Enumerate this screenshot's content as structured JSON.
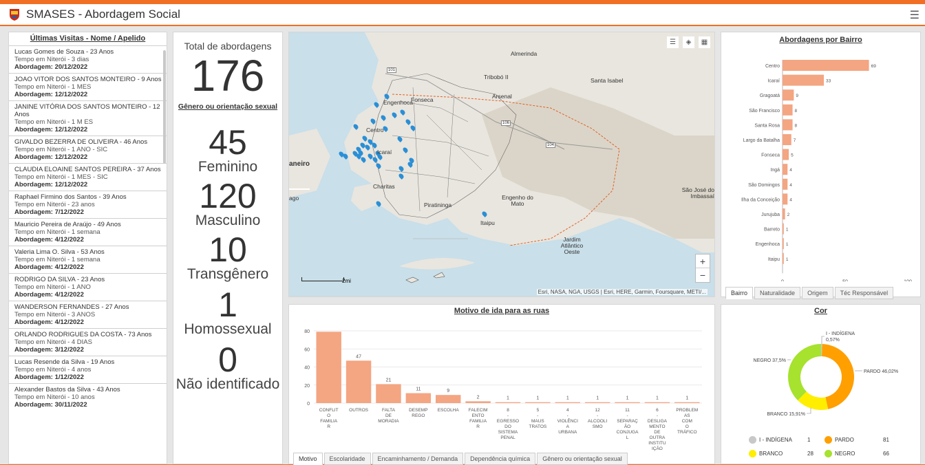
{
  "app": {
    "title": "SMASES - Abordagem Social"
  },
  "visits": {
    "heading": "Últimas Visitas - Nome / Apelido",
    "items": [
      {
        "name": "Lucas Gomes de Souza - 23 Anos",
        "tempo": "Tempo em Niterói - 3 dias",
        "abordagem": "Abordagem: 20/12/2022"
      },
      {
        "name": "JOAO VITOR DOS SANTOS MONTEIRO - 9 Anos",
        "tempo": "Tempo em Niterói - 1 MES",
        "abordagem": "Abordagem: 12/12/2022"
      },
      {
        "name": "JANINE VITÓRIA DOS SANTOS MONTEIRO - 12 Anos",
        "tempo": "Tempo em Niterói - 1 M ES",
        "abordagem": "Abordagem: 12/12/2022"
      },
      {
        "name": "GIVALDO BEZERRA DE OLIVEIRA - 46 Anos",
        "tempo": "Tempo em Niterói - 1 ANO - SIC",
        "abordagem": "Abordagem: 12/12/2022"
      },
      {
        "name": "CLAUDIA ELOAINE SANTOS PEREIRA - 37 Anos",
        "tempo": "Tempo em Niterói - 1 MES - SIC",
        "abordagem": "Abordagem: 12/12/2022"
      },
      {
        "name": "Raphael Firmino dos Santos - 39 Anos",
        "tempo": "Tempo em Niterói - 23 anos",
        "abordagem": "Abordagem: 7/12/2022"
      },
      {
        "name": "Mauricio Pereira de Araújo - 49 Anos",
        "tempo": "Tempo em Niterói - 1 semana",
        "abordagem": "Abordagem: 4/12/2022"
      },
      {
        "name": "Valeria Lima O. Silva - 53 Anos",
        "tempo": "Tempo em Niterói - 1 semana",
        "abordagem": "Abordagem: 4/12/2022"
      },
      {
        "name": "RODRIGO DA SILVA - 23 Anos",
        "tempo": "Tempo em Niterói - 1 ANO",
        "abordagem": "Abordagem: 4/12/2022"
      },
      {
        "name": "WANDERSON FERNANDES - 27 Anos",
        "tempo": "Tempo em Niterói - 3 ANOS",
        "abordagem": "Abordagem: 4/12/2022"
      },
      {
        "name": "ORLANDO RODRIGUES DA COSTA - 73 Anos",
        "tempo": "Tempo em Niterói - 4 DIAS",
        "abordagem": "Abordagem: 3/12/2022"
      },
      {
        "name": "Lucas Resende da Silva - 19 Anos",
        "tempo": "Tempo em Niterói - 4 anos",
        "abordagem": "Abordagem: 1/12/2022"
      },
      {
        "name": "Alexander Bastos da Silva - 43 Anos",
        "tempo": "Tempo em Niterói - 10 anos",
        "abordagem": "Abordagem: 30/11/2022"
      }
    ]
  },
  "stats": {
    "total_label": "Total de abordagens",
    "total": "176",
    "section": "Gênero ou orientação sexual",
    "items": [
      {
        "value": "45",
        "label": "Feminino"
      },
      {
        "value": "120",
        "label": "Masculino"
      },
      {
        "value": "10",
        "label": "Transgênero"
      },
      {
        "value": "1",
        "label": "Homossexual"
      },
      {
        "value": "0",
        "label": "Não identificado"
      }
    ]
  },
  "map": {
    "places": [
      "Almerinda",
      "Tribobó II",
      "Santa Isabel",
      "Arsenal",
      "Fonseca",
      "Engenhoca",
      "Icaraí",
      "Charitas",
      "Piratininga",
      "Engenho do Mato",
      "Itaipu",
      "Jardim Atlântico Oeste",
      "São José do Imbassaí",
      "aneiro",
      "ago",
      "Centro"
    ],
    "roads": [
      "101",
      "106",
      "104"
    ],
    "scale_label": "2mi",
    "attribution": "Esri, NASA, NGA, USGS | Esri, HERE, Garmin, Foursquare, METI/...",
    "zoom_in": "+",
    "zoom_out": "−",
    "tools": [
      "list-icon",
      "layers-icon",
      "basemap-icon"
    ]
  },
  "bairro_chart": {
    "title": "Abordagens por Bairro",
    "tabs": [
      "Bairro",
      "Naturalidade",
      "Origem",
      "Téc Responsável"
    ],
    "chart_data": {
      "type": "bar",
      "orientation": "horizontal",
      "categories": [
        "Centro",
        "Icaraí",
        "Gragoatá",
        "São Francisco",
        "Santa Rosa",
        "Largo da Batalha",
        "Fonseca",
        "Ingá",
        "São Domingos",
        "Ilha da Conceição",
        "Jurujuba",
        "Barreto",
        "Engenhoca",
        "Itaipu"
      ],
      "values": [
        69,
        33,
        9,
        8,
        8,
        7,
        5,
        4,
        4,
        4,
        2,
        1,
        1,
        1
      ],
      "xlim": [
        0,
        100
      ],
      "xticks": [
        "0",
        "50",
        "100"
      ],
      "color": "#f4a582"
    }
  },
  "motivo_chart": {
    "title": "Motivo de ida para as ruas",
    "tabs": [
      "Motivo",
      "Escolaridade",
      "Encaminhamento / Demanda",
      "Dependência química",
      "Gênero ou orientação sexual"
    ],
    "chart_data": {
      "type": "bar",
      "categories": [
        "CONFLIT O FAMILIA R",
        "OUTROS",
        "FALTA DE MORADIA",
        "DESEMP REGO",
        "ESCOLHA",
        "FALECIM ENTO FAMILIA R",
        "8 - EGRESSO DO SISTEMA PENAL",
        "5 - MAUS TRATOS",
        "4 - VIOLÊNCI A URBANA",
        "12 - ALCOOLI SMO",
        "11 - SEPARAÇ ÃO CONJUGA L",
        "6 - DESLIGA MENTO DE OUTRA INSTITU IÇÃO",
        "PROBLEM AS COM O TRÁFICO"
      ],
      "values": [
        79,
        47,
        21,
        11,
        9,
        2,
        1,
        1,
        1,
        1,
        1,
        1,
        1
      ],
      "labels": [
        "",
        "47",
        "21",
        "11",
        "9",
        "2",
        "1",
        "1",
        "1",
        "1",
        "1",
        "1",
        "1"
      ],
      "ylim": [
        0,
        80
      ],
      "yticks": [
        "0",
        "20",
        "40",
        "60",
        "80"
      ],
      "color": "#f4a582"
    }
  },
  "cor_chart": {
    "title": "Cor",
    "chart_data": {
      "type": "pie",
      "donut": true,
      "slices": [
        {
          "label": "I - INDÍGENA",
          "pct_label": "0,57%",
          "value": 1,
          "color": "#c8c8c8"
        },
        {
          "label": "PARDO",
          "pct_label": "46,02%",
          "value": 81,
          "color": "#ff9f00"
        },
        {
          "label": "BRANCO",
          "pct_label": "15,91%",
          "value": 28,
          "color": "#ffee00"
        },
        {
          "label": "NEGRO",
          "pct_label": "37,5%",
          "value": 66,
          "color": "#a6e22e"
        }
      ]
    },
    "callouts": [
      "I - INDÍGENA 0,57%",
      "PARDO 46,02%",
      "BRANCO 15,91%",
      "NEGRO 37,5%"
    ],
    "legend": [
      {
        "label": "I - INDÍGENA",
        "count": "1",
        "color": "#c8c8c8"
      },
      {
        "label": "PARDO",
        "count": "81",
        "color": "#ff9f00"
      },
      {
        "label": "BRANCO",
        "count": "28",
        "color": "#ffee00"
      },
      {
        "label": "NEGRO",
        "count": "66",
        "color": "#a6e22e"
      }
    ]
  }
}
